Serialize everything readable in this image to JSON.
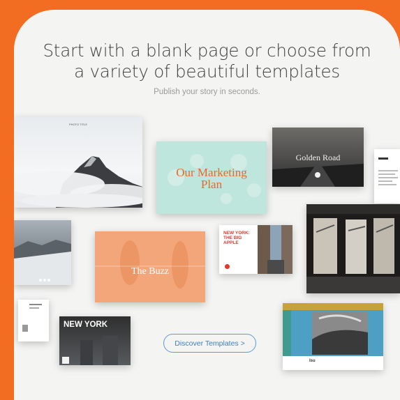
{
  "header": {
    "title_line1": "Start with a blank page or choose from",
    "title_line2": "a variety of beautiful templates",
    "subtitle": "Publish your story in seconds."
  },
  "templates": {
    "mountain": {
      "head_left": "PHOTO TITLE"
    },
    "marketing": {
      "title_line1": "Our Marketing",
      "title_line2": "Plan"
    },
    "golden": {
      "title": "Golden Road"
    },
    "buzz": {
      "title": "The Buzz"
    },
    "nyapple": {
      "title": "NEW YORK: THE BIG APPLE"
    },
    "newyork": {
      "title": "NEW YORK"
    },
    "bw": {
      "caption": "Isu"
    }
  },
  "cta": {
    "label": "Discover Templates >"
  },
  "colors": {
    "background": "#f26c22",
    "card": "#f4f4f3",
    "accent": "#3b7fc4"
  }
}
